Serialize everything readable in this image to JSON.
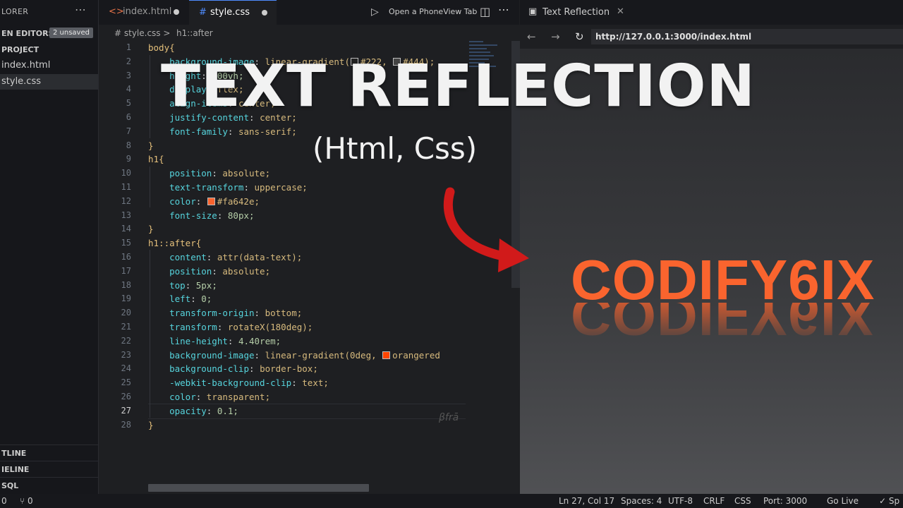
{
  "sidebar": {
    "title": "LORER",
    "more": "⋯",
    "open_editors": {
      "label": "EN EDITORS",
      "badge": "2 unsaved"
    },
    "project": "PROJECT",
    "files": [
      {
        "name": "index.html",
        "active": false
      },
      {
        "name": "style.css",
        "active": true
      }
    ],
    "bottom": [
      {
        "label": "TLINE"
      },
      {
        "label": "IELINE"
      },
      {
        "label": "SQL"
      }
    ]
  },
  "editor_tabs": [
    {
      "icon": "html-icon",
      "glyph": "<>",
      "label": "index.html",
      "dirty": true
    },
    {
      "icon": "css-icon",
      "glyph": "#",
      "label": "style.css",
      "dirty": true
    }
  ],
  "toolbar": {
    "phoneview": "Open a PhoneView Tab"
  },
  "breadcrumb": {
    "file": "# style.css >",
    "symbol": "h1::after"
  },
  "code_lines": [
    {
      "n": "1",
      "parts": [
        [
          "sel",
          "body{"
        ]
      ]
    },
    {
      "n": "2",
      "parts": [
        [
          "prop",
          "    background-image"
        ],
        [
          "punc",
          ": "
        ],
        [
          "val",
          "linear-gradient("
        ],
        [
          "swatch",
          "#222222"
        ],
        [
          "val",
          "#222, "
        ],
        [
          "swatch",
          "#444444"
        ],
        [
          "val",
          "#444);"
        ]
      ]
    },
    {
      "n": "3",
      "parts": [
        [
          "prop",
          "    height"
        ],
        [
          "punc",
          ": "
        ],
        [
          "num",
          "100vh;"
        ]
      ]
    },
    {
      "n": "4",
      "parts": [
        [
          "prop",
          "    display"
        ],
        [
          "punc",
          ": "
        ],
        [
          "val",
          "flex;"
        ]
      ]
    },
    {
      "n": "5",
      "parts": [
        [
          "prop",
          "    align-items"
        ],
        [
          "punc",
          ": "
        ],
        [
          "val",
          "center;"
        ]
      ]
    },
    {
      "n": "6",
      "parts": [
        [
          "prop",
          "    justify-content"
        ],
        [
          "punc",
          ": "
        ],
        [
          "val",
          "center;"
        ]
      ]
    },
    {
      "n": "7",
      "parts": [
        [
          "prop",
          "    font-family"
        ],
        [
          "punc",
          ": "
        ],
        [
          "val",
          "sans-serif;"
        ]
      ]
    },
    {
      "n": "8",
      "parts": [
        [
          "sel",
          "}"
        ]
      ]
    },
    {
      "n": "9",
      "parts": [
        [
          "sel",
          "h1{"
        ]
      ]
    },
    {
      "n": "10",
      "parts": [
        [
          "prop",
          "    position"
        ],
        [
          "punc",
          ": "
        ],
        [
          "val",
          "absolute;"
        ]
      ]
    },
    {
      "n": "11",
      "parts": [
        [
          "prop",
          "    text-transform"
        ],
        [
          "punc",
          ": "
        ],
        [
          "val",
          "uppercase;"
        ]
      ]
    },
    {
      "n": "12",
      "parts": [
        [
          "prop",
          "    color"
        ],
        [
          "punc",
          ": "
        ],
        [
          "swatch",
          "#fa642e"
        ],
        [
          "val",
          "#fa642e;"
        ]
      ]
    },
    {
      "n": "13",
      "parts": [
        [
          "prop",
          "    font-size"
        ],
        [
          "punc",
          ": "
        ],
        [
          "num",
          "80px;"
        ]
      ]
    },
    {
      "n": "14",
      "parts": [
        [
          "sel",
          "}"
        ]
      ]
    },
    {
      "n": "15",
      "parts": [
        [
          "sel",
          "h1::after{"
        ]
      ]
    },
    {
      "n": "16",
      "parts": [
        [
          "prop",
          "    content"
        ],
        [
          "punc",
          ": "
        ],
        [
          "val",
          "attr(data-text);"
        ]
      ]
    },
    {
      "n": "17",
      "parts": [
        [
          "prop",
          "    position"
        ],
        [
          "punc",
          ": "
        ],
        [
          "val",
          "absolute;"
        ]
      ]
    },
    {
      "n": "18",
      "parts": [
        [
          "prop",
          "    top"
        ],
        [
          "punc",
          ": "
        ],
        [
          "num",
          "5px;"
        ]
      ]
    },
    {
      "n": "19",
      "parts": [
        [
          "prop",
          "    left"
        ],
        [
          "punc",
          ": "
        ],
        [
          "num",
          "0;"
        ]
      ]
    },
    {
      "n": "20",
      "parts": [
        [
          "prop",
          "    transform-origin"
        ],
        [
          "punc",
          ": "
        ],
        [
          "val",
          "bottom;"
        ]
      ]
    },
    {
      "n": "21",
      "parts": [
        [
          "prop",
          "    transform"
        ],
        [
          "punc",
          ": "
        ],
        [
          "val",
          "rotateX(180deg);"
        ]
      ]
    },
    {
      "n": "22",
      "parts": [
        [
          "prop",
          "    line-height"
        ],
        [
          "punc",
          ": "
        ],
        [
          "num",
          "4.40rem;"
        ]
      ]
    },
    {
      "n": "23",
      "parts": [
        [
          "prop",
          "    background-image"
        ],
        [
          "punc",
          ": "
        ],
        [
          "val",
          "linear-gradient(0deg, "
        ],
        [
          "swatch",
          "#ff4500"
        ],
        [
          "val",
          "orangered"
        ]
      ]
    },
    {
      "n": "24",
      "parts": [
        [
          "prop",
          "    background-clip"
        ],
        [
          "punc",
          ": "
        ],
        [
          "val",
          "border-box;"
        ]
      ]
    },
    {
      "n": "25",
      "parts": [
        [
          "prop",
          "    -webkit-background-clip"
        ],
        [
          "punc",
          ": "
        ],
        [
          "val",
          "text;"
        ]
      ]
    },
    {
      "n": "26",
      "parts": [
        [
          "prop",
          "    color"
        ],
        [
          "punc",
          ": "
        ],
        [
          "val",
          "transparent;"
        ]
      ]
    },
    {
      "n": "27",
      "parts": [
        [
          "prop",
          "    opacity"
        ],
        [
          "punc",
          ": "
        ],
        [
          "num",
          "0.1;"
        ]
      ]
    },
    {
      "n": "28",
      "parts": [
        [
          "sel",
          "}"
        ]
      ]
    }
  ],
  "current_line": "27",
  "browser": {
    "tab_label": "Text Reflection",
    "url": "http://127.0.0.1:3000/index.html",
    "heading": "CODIFY6IX"
  },
  "overlay": {
    "title": "TEXT REFLECTION",
    "subtitle": "(Html, Css)"
  },
  "watermark": "βfrā",
  "statusbar": {
    "left_a": "0",
    "left_b": "⑂ 0",
    "position": "Ln 27, Col 17",
    "spaces": "Spaces: 4",
    "encoding": "UTF-8",
    "eol": "CRLF",
    "language": "CSS",
    "port": "Port: 3000",
    "golive": "Go Live",
    "extra": "✓ Sp"
  },
  "colors": {
    "accent": "#4f8cff",
    "brand": "#fa642e",
    "arrow": "#d11a1a"
  }
}
